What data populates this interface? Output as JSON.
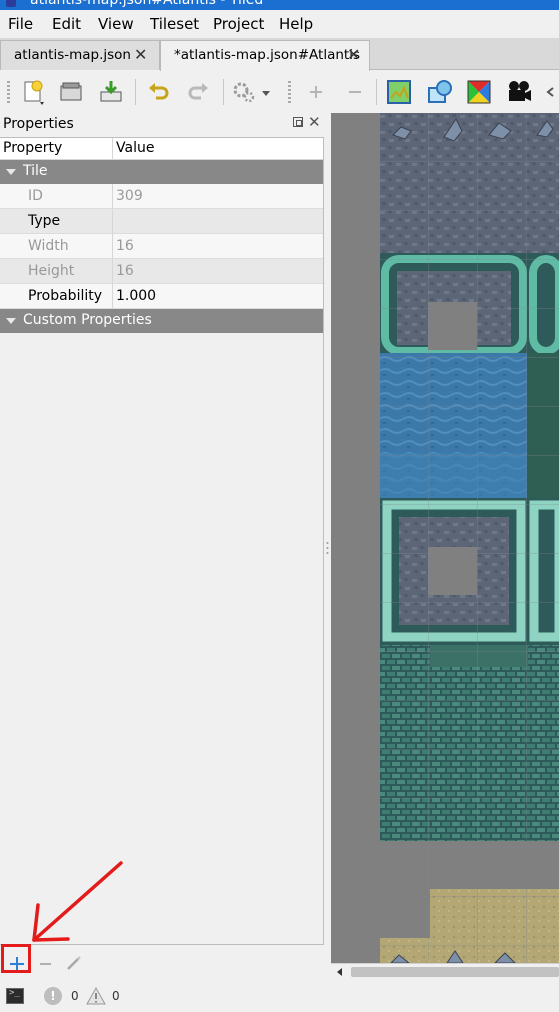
{
  "window": {
    "title": "atlantis-map.json#Atlantis - Tiled"
  },
  "menu": [
    "File",
    "Edit",
    "View",
    "Tileset",
    "Project",
    "Help"
  ],
  "tabs": [
    {
      "label": "atlantis-map.json",
      "active": false
    },
    {
      "label": "*atlantis-map.json#Atlantis",
      "active": true
    }
  ],
  "toolbar": {
    "icons": [
      "new-file-icon",
      "open-file-icon",
      "save-file-icon",
      "undo-icon",
      "redo-icon",
      "command-icon",
      "dropdown-arrow-icon",
      "zoom-in-icon",
      "zoom-out-icon",
      "tileset-properties-icon",
      "collision-editor-icon",
      "terrain-editor-icon",
      "animation-editor-icon"
    ]
  },
  "properties": {
    "title": "Properties",
    "header": {
      "property": "Property",
      "value": "Value"
    },
    "groups": [
      {
        "name": "Tile",
        "rows": [
          {
            "key": "ID",
            "value": "309",
            "enabled": false
          },
          {
            "key": "Type",
            "value": "",
            "enabled": true
          },
          {
            "key": "Width",
            "value": "16",
            "enabled": false
          },
          {
            "key": "Height",
            "value": "16",
            "enabled": false
          },
          {
            "key": "Probability",
            "value": "1.000",
            "enabled": true
          }
        ]
      },
      {
        "name": "Custom Properties",
        "rows": []
      }
    ]
  },
  "status": {
    "errors": "0",
    "warnings": "0"
  },
  "annotation": {
    "color": "#e31b1b",
    "target": "add-property-button"
  },
  "colors": {
    "accent": "#2f7fd6",
    "group_header": "#888888",
    "map_background": "#808080"
  }
}
